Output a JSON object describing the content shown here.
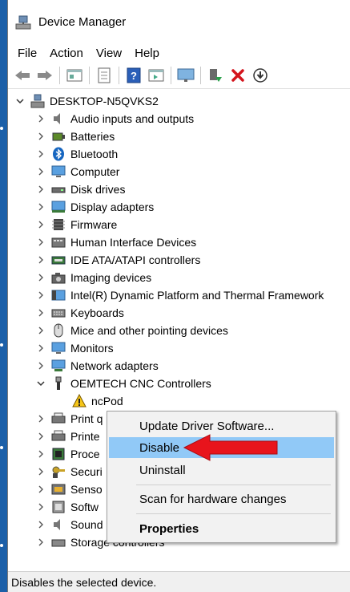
{
  "window": {
    "title": "Device Manager"
  },
  "menu": [
    "File",
    "Action",
    "View",
    "Help"
  ],
  "toolbar": {
    "buttons": [
      "back-icon",
      "forward-icon",
      "properties-icon",
      "update-icon",
      "help-icon",
      "view-icon",
      "monitor-icon",
      "enable-icon",
      "uninstall-icon",
      "scan-icon"
    ]
  },
  "tree": {
    "root": "DESKTOP-N5QVKS2",
    "items": [
      "Audio inputs and outputs",
      "Batteries",
      "Bluetooth",
      "Computer",
      "Disk drives",
      "Display adapters",
      "Firmware",
      "Human Interface Devices",
      "IDE ATA/ATAPI controllers",
      "Imaging devices",
      "Intel(R) Dynamic Platform and Thermal Framework",
      "Keyboards",
      "Mice and other pointing devices",
      "Monitors",
      "Network adapters",
      "OEMTECH CNC Controllers"
    ],
    "child": "ncPod",
    "items_after": [
      "Print q",
      "Printe",
      "Proce",
      "Securi",
      "Senso",
      "Softw",
      "Sound",
      "Storage controllers"
    ]
  },
  "context_menu": {
    "items": [
      "Update Driver Software...",
      "Disable",
      "Uninstall",
      "Scan for hardware changes",
      "Properties"
    ],
    "highlighted": "Disable"
  },
  "status": {
    "text": "Disables the selected device."
  },
  "colors": {
    "accent_highlight": "#91c9f7",
    "arrow": "#e8141c",
    "desktop": "#1b5fa8"
  }
}
